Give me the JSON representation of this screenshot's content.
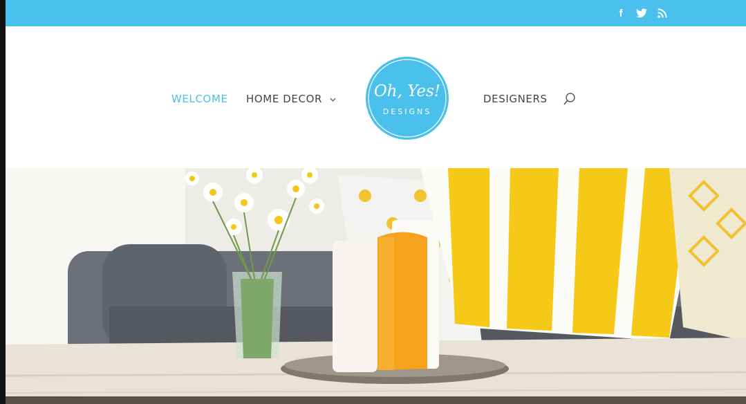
{
  "social": {
    "icons": [
      "facebook-icon",
      "twitter-icon",
      "rss-icon"
    ],
    "facebook_glyph": "f"
  },
  "nav": {
    "items": [
      {
        "label": "WELCOME",
        "active": true
      },
      {
        "label": "HOME DECOR",
        "has_dropdown": true
      },
      {
        "label": "DESIGNERS"
      }
    ],
    "search_icon": "search-icon"
  },
  "logo": {
    "line1": "Oh, Yes!",
    "line2": "DESIGNS"
  },
  "hero": {
    "image": "living room with yellow pillows, daisies in a vase and candles on a tray"
  },
  "colors": {
    "accent": "#49c1ec",
    "nav_text": "#444444",
    "header_bg": "#ffffff"
  }
}
